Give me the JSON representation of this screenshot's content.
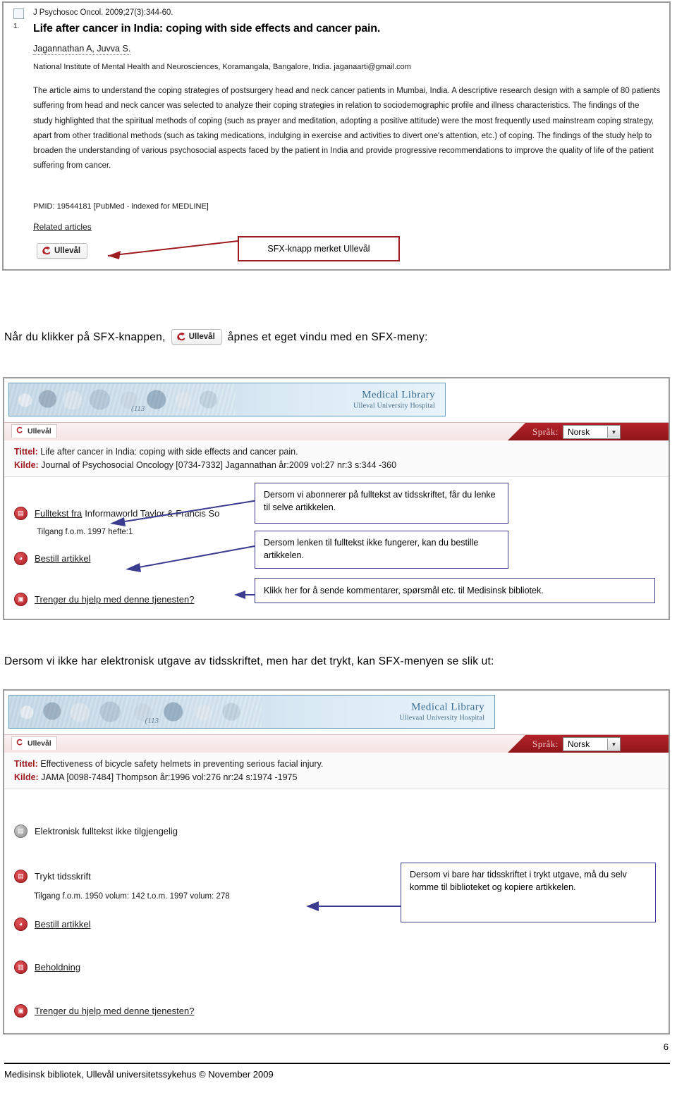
{
  "pubmed_record": {
    "index": "1.",
    "journal_citation": "J Psychosoc Oncol. 2009;27(3):344-60.",
    "title": "Life after cancer in India: coping with side effects and cancer pain.",
    "authors": "Jagannathan A, Juvva S.",
    "affiliation": "National Institute of Mental Health and Neurosciences, Koramangala, Bangalore, India. jaganaarti@gmail.com",
    "abstract": "The article aims to understand the coping strategies of postsurgery head and neck cancer patients in Mumbai, India. A descriptive research design with a sample of 80 patients suffering from head and neck cancer was selected to analyze their coping strategies in relation to sociodemographic profile and illness characteristics. The findings of the study highlighted that the spiritual methods of coping (such as prayer and meditation, adopting a positive attitude) were the most frequently used mainstream coping strategy, apart from other traditional methods (such as taking medications, indulging in exercise and activities to divert one's attention, etc.) of coping. The findings of the study help to broaden the understanding of various psychosocial aspects faced by the patient in India and provide progressive recommendations to improve the quality of life of the patient suffering from cancer.",
    "pmid": "PMID: 19544181 [PubMed - indexed for MEDLINE]",
    "related_articles": "Related articles",
    "sfx_button_label": "Ullevål",
    "callout": "SFX-knapp merket Ullevål"
  },
  "intro_paragraph": {
    "before": "Når du klikker på SFX-knappen,",
    "button_label": "Ullevål",
    "after": "åpnes et eget vindu med en SFX-meny:"
  },
  "sfx_window_1": {
    "banner_title": "Medical Library",
    "banner_subtitle": "Ulleval University Hospital",
    "banner_watermark": "(113",
    "tab_label": "Ullevål",
    "language_label": "Språk:",
    "language_value": "Norsk",
    "meta": {
      "title_key": "Tittel:",
      "title_value": "Life after cancer in India: coping with side effects and cancer pain.",
      "source_key": "Kilde:",
      "source_value": "Journal of Psychosocial Oncology [0734-7332] Jagannathan år:2009 vol:27 nr:3 s:344 -360"
    },
    "rows": [
      {
        "link_text": "Fulltekst fra",
        "plain_text": "Informaworld Taylor & Francis So",
        "icon": "red-document-icon"
      },
      {
        "sub_text": "Tilgang f.o.m. 1997 hefte:1"
      },
      {
        "link_text": "Bestill artikkel",
        "icon": "red-order-icon"
      },
      {
        "link_text": "Trenger du hjelp med denne tjenesten?",
        "icon": "red-help-icon"
      }
    ],
    "callouts": [
      "Dersom vi abonnerer på fulltekst av tidsskriftet, får du lenke til selve artikkelen.",
      "Dersom lenken til fulltekst ikke fungerer, kan du bestille artikkelen.",
      "Klikk her for å sende kommentarer, spørsmål etc. til Medisinsk bibliotek."
    ]
  },
  "bottom_heading": "Dersom vi ikke har elektronisk utgave av tidsskriftet, men har det trykt, kan SFX-menyen se slik ut:",
  "sfx_window_2": {
    "banner_title": "Medical Library",
    "banner_subtitle": "Ullevaal University Hospital",
    "banner_watermark": "(113",
    "tab_label": "Ullevål",
    "language_label": "Språk:",
    "language_value": "Norsk",
    "meta": {
      "title_key": "Tittel:",
      "title_value": "Effectiveness of bicycle safety helmets in preventing serious facial injury.",
      "source_key": "Kilde:",
      "source_value": "JAMA [0098-7484] Thompson år:1996 vol:276 nr:24 s:1974 -1975"
    },
    "rows": [
      {
        "plain_text": "Elektronisk fulltekst ikke tilgjengelig",
        "icon": "grey-document-icon"
      },
      {
        "plain_text": "Trykt tidsskrift",
        "icon": "red-journal-icon"
      },
      {
        "sub_text": "Tilgang f.o.m. 1950 volum: 142 t.o.m. 1997 volum: 278"
      },
      {
        "link_text": "Bestill artikkel",
        "icon": "red-order-icon"
      },
      {
        "link_text": "Beholdning",
        "icon": "red-holdings-icon"
      },
      {
        "link_text": "Trenger du hjelp med denne tjenesten?",
        "icon": "red-help-icon"
      }
    ],
    "callout": "Dersom vi bare har tidsskriftet i trykt utgave, må du selv komme til biblioteket og kopiere artikkelen."
  },
  "footer": {
    "text": "Medisinsk bibliotek, Ullevål universitetssykehus  ©   November 2009",
    "page_number": "6"
  },
  "colors": {
    "sfx_red": "#9e1b20",
    "annotation_blue": "#3b3b8f",
    "banner_blue": "#3d6f94",
    "frame_grey": "#9c9c9c"
  }
}
